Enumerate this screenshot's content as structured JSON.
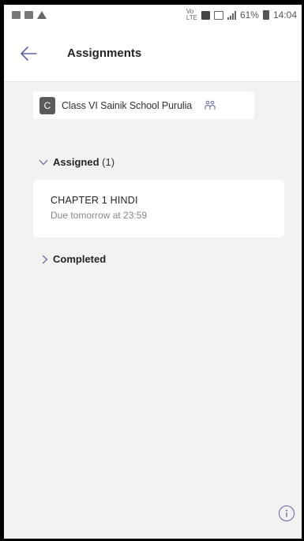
{
  "status_bar": {
    "battery": "61%",
    "time": "14:04",
    "left_icons": [
      "gallery-icon",
      "image-icon",
      "warning-icon"
    ],
    "right_icons": [
      "volte-icon",
      "sim-icon",
      "lte-icon",
      "signal-icon",
      "battery-icon"
    ]
  },
  "header": {
    "title": "Assignments",
    "back_icon": "arrow-left-icon"
  },
  "class_selector": {
    "avatar_letter": "C",
    "class_name": "Class VI Sainik School Purulia",
    "switch_icon": "switch-class-icon"
  },
  "sections": {
    "assigned": {
      "label": "Assigned",
      "count": "(1)",
      "expanded": true,
      "items": [
        {
          "title": "CHAPTER 1 HINDI",
          "due": "Due tomorrow at 23:59"
        }
      ]
    },
    "completed": {
      "label": "Completed",
      "expanded": false
    }
  },
  "footer": {
    "info_icon": "info-icon"
  },
  "colors": {
    "accent": "#6264a7",
    "background": "#f3f2f1",
    "card": "#ffffff"
  }
}
